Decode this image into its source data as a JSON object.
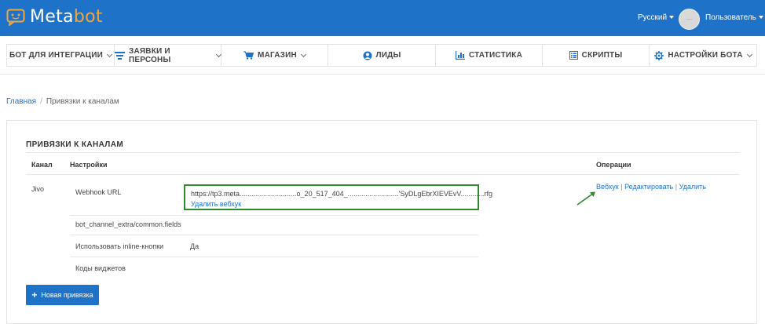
{
  "header": {
    "logo_main": "Meta",
    "logo_accent": "bot",
    "language": "Русский",
    "user": "Пользователь",
    "avatar_text": "—"
  },
  "nav": {
    "items": [
      {
        "label": "БОТ ДЛЯ ИНТЕГРАЦИИ",
        "icon": "none",
        "dropdown": true
      },
      {
        "label": "ЗАЯВКИ И ПЕРСОНЫ",
        "icon": "filter-icon",
        "dropdown": true
      },
      {
        "label": "МАГАЗИН",
        "icon": "cart-icon",
        "dropdown": true
      },
      {
        "label": "ЛИДЫ",
        "icon": "user-circle-icon",
        "dropdown": false
      },
      {
        "label": "СТАТИСТИКА",
        "icon": "bar-chart-icon",
        "dropdown": false
      },
      {
        "label": "СКРИПТЫ",
        "icon": "list-icon",
        "dropdown": false
      },
      {
        "label": "НАСТРОЙКИ БОТА",
        "icon": "gear-icon",
        "dropdown": true
      }
    ]
  },
  "breadcrumb": {
    "home": "Главная",
    "separator": "/",
    "current": "Привязки к каналам"
  },
  "panel": {
    "title": "ПРИВЯЗКИ К КАНАЛАМ",
    "col_channel": "Канал",
    "col_settings": "Настройки",
    "col_operations": "Операции",
    "channel": "Jivo",
    "settings": {
      "webhook_label": "Webhook URL",
      "webhook_url": "https://tp3.meta.............................o_20_517_404_..........................'SyDLgEbrXIEVEvV............rfg",
      "webhook_delete": "Удалить вебхук",
      "extra_fields_label": "bot_channel_extra/common.fields",
      "inline_buttons_label": "Использовать inline-кнопки",
      "inline_buttons_value": "Да",
      "widget_codes_label": "Коды виджетов"
    },
    "operations": {
      "webhook": "Вебхук",
      "edit": "Редактировать",
      "delete": "Удалить",
      "sep": "|"
    },
    "new_button": "Новая привязка",
    "new_button_icon": "+"
  },
  "colors": {
    "brand_blue": "#1e73c8",
    "logo_accent": "#f2a53a",
    "highlight_green": "#2d8a2d"
  }
}
